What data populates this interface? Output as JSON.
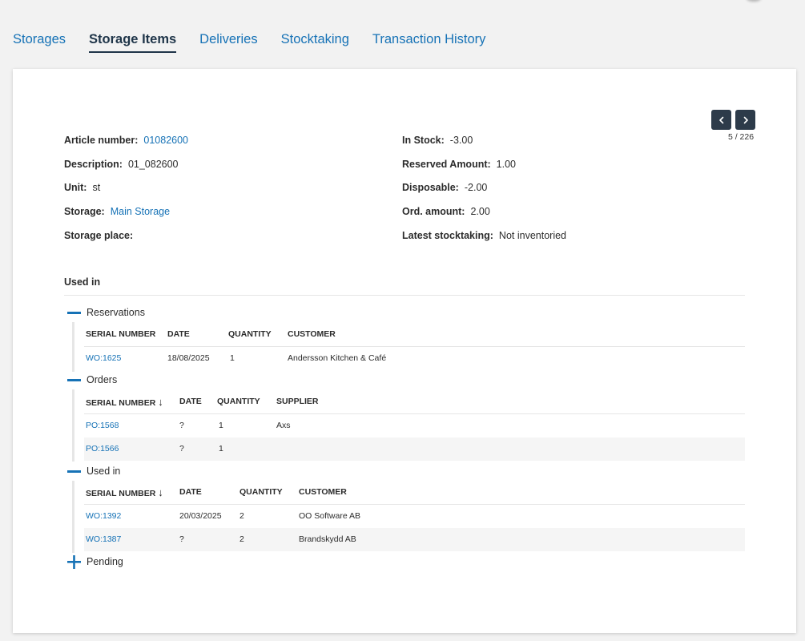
{
  "tabs": [
    "Storages",
    "Storage Items",
    "Deliveries",
    "Stocktaking",
    "Transaction History"
  ],
  "active_tab": "Storage Items",
  "pager": {
    "count": "5 / 226",
    "prev_icon": "chevron-left-icon",
    "next_icon": "chevron-right-icon"
  },
  "details": {
    "article_number": {
      "label": "Article number:",
      "value": "01082600"
    },
    "description": {
      "label": "Description:",
      "value": "01_082600"
    },
    "unit": {
      "label": "Unit:",
      "value": "st"
    },
    "storage": {
      "label": "Storage:",
      "value": "Main Storage"
    },
    "storage_place": {
      "label": "Storage place:",
      "value": ""
    },
    "in_stock": {
      "label": "In Stock:",
      "value": "-3.00"
    },
    "reserved_amount": {
      "label": "Reserved Amount:",
      "value": "1.00"
    },
    "disposable": {
      "label": "Disposable:",
      "value": "-2.00"
    },
    "ord_amount": {
      "label": "Ord. amount:",
      "value": "2.00"
    },
    "latest_stocktaking": {
      "label": "Latest stocktaking:",
      "value": "Not inventoried"
    }
  },
  "used_in_title": "Used in",
  "groups": {
    "reservations": {
      "title": "Reservations",
      "columns": [
        "SERIAL NUMBER",
        "DATE",
        "QUANTITY",
        "CUSTOMER"
      ],
      "rows": [
        [
          "WO:1625",
          "18/08/2025",
          "1",
          "Andersson Kitchen & Café"
        ]
      ]
    },
    "orders": {
      "title": "Orders",
      "sort_icon": "↓",
      "columns": [
        "SERIAL NUMBER",
        "DATE",
        "QUANTITY",
        "SUPPLIER"
      ],
      "rows": [
        [
          "PO:1568",
          "?",
          "1",
          "Axs"
        ],
        [
          "PO:1566",
          "?",
          "1",
          ""
        ]
      ]
    },
    "used_in": {
      "title": "Used in",
      "sort_icon": "↓",
      "columns": [
        "SERIAL NUMBER",
        "DATE",
        "QUANTITY",
        "CUSTOMER"
      ],
      "rows": [
        [
          "WO:1392",
          "20/03/2025",
          "2",
          "OO Software AB"
        ],
        [
          "WO:1387",
          "?",
          "2",
          "Brandskydd AB"
        ]
      ]
    },
    "pending": {
      "title": "Pending"
    }
  },
  "colors": {
    "accent": "#1672b6",
    "dark": "#1f3549",
    "button": "#2d3b4a"
  }
}
